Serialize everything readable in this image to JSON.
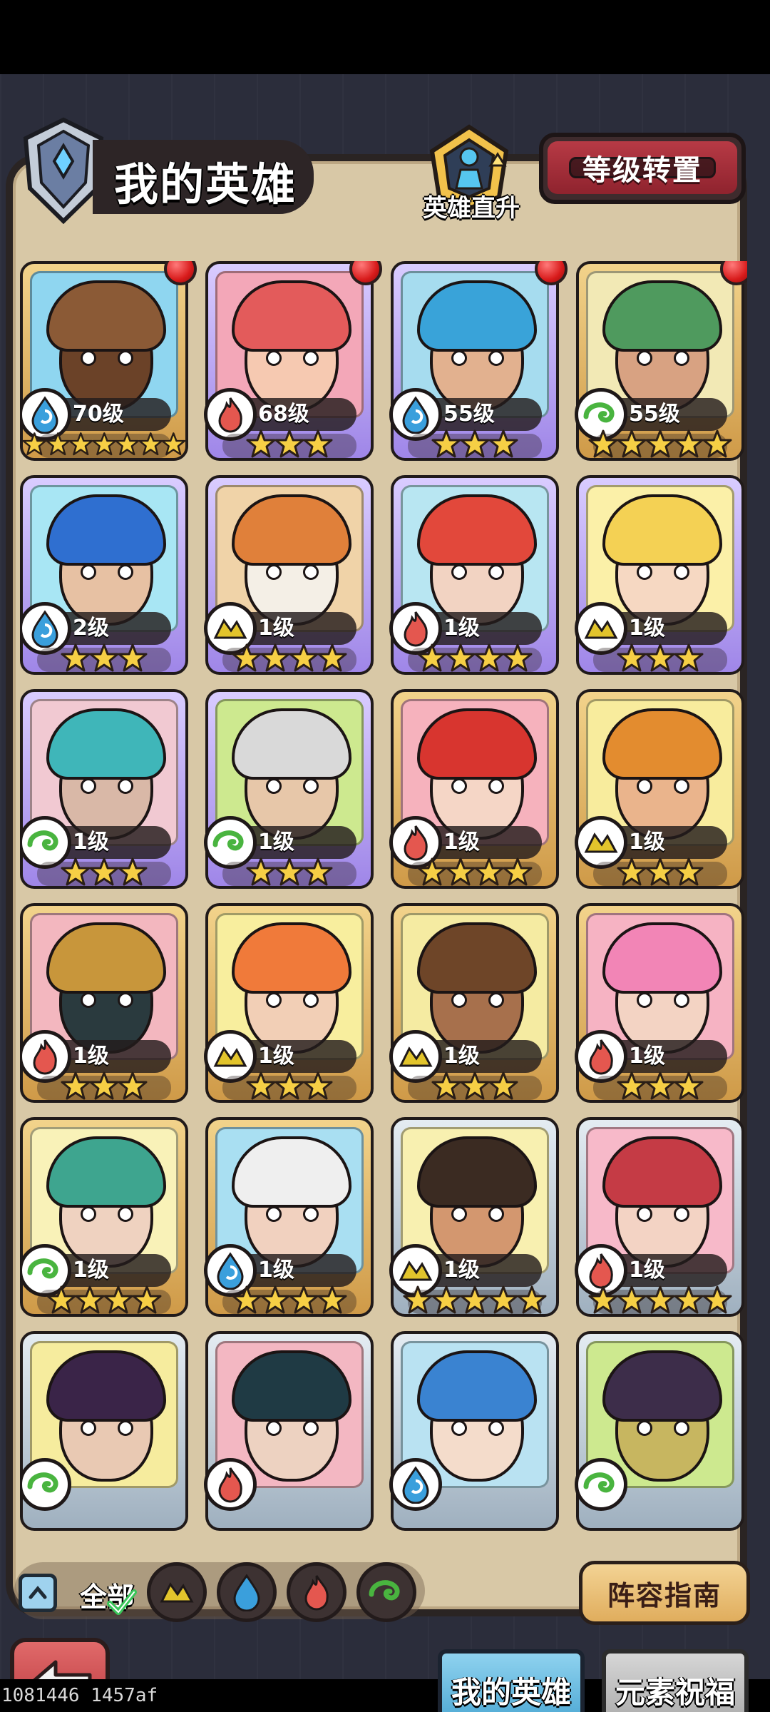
{
  "header": {
    "title": "我的英雄",
    "direct_upgrade_label": "英雄直升",
    "level_transfer_label": "等级转置"
  },
  "heroes": [
    {
      "level": "70级",
      "element": "water",
      "stars": 7,
      "frame": "gold",
      "notify": true,
      "palette": [
        "#8fd6f0",
        "#8b5a36",
        "#6b4228"
      ]
    },
    {
      "level": "68级",
      "element": "fire",
      "stars": 3,
      "frame": "purple",
      "notify": true,
      "palette": [
        "#f3a7b8",
        "#e35b5b",
        "#f6c9b1"
      ]
    },
    {
      "level": "55级",
      "element": "water",
      "stars": 3,
      "frame": "purple",
      "notify": true,
      "palette": [
        "#a6dcef",
        "#39a3d9",
        "#e2b18f"
      ]
    },
    {
      "level": "55级",
      "element": "wind",
      "stars": 5,
      "frame": "gold",
      "notify": true,
      "palette": [
        "#f2e9b5",
        "#4f9a5e",
        "#d8a282"
      ]
    },
    {
      "level": "2级",
      "element": "water",
      "stars": 3,
      "frame": "purple",
      "notify": false,
      "palette": [
        "#a8e6f4",
        "#2f6fd0",
        "#e7c1a3"
      ]
    },
    {
      "level": "1级",
      "element": "earth",
      "stars": 4,
      "frame": "purple",
      "notify": false,
      "palette": [
        "#f0d3a8",
        "#e0803a",
        "#f4efe6"
      ]
    },
    {
      "level": "1级",
      "element": "fire",
      "stars": 4,
      "frame": "purple",
      "notify": false,
      "palette": [
        "#b8e6f2",
        "#e2483b",
        "#f2d3c2"
      ]
    },
    {
      "level": "1级",
      "element": "earth",
      "stars": 3,
      "frame": "purple",
      "notify": false,
      "palette": [
        "#fbf0a8",
        "#f4d154",
        "#f6d8c2"
      ]
    },
    {
      "level": "1级",
      "element": "wind",
      "stars": 3,
      "frame": "purple",
      "notify": false,
      "palette": [
        "#f1c9d2",
        "#3fb6b9",
        "#d9b8a7"
      ]
    },
    {
      "level": "1级",
      "element": "wind",
      "stars": 3,
      "frame": "purple",
      "notify": false,
      "palette": [
        "#cde98f",
        "#d9d9d9",
        "#e7c7a9"
      ]
    },
    {
      "level": "1级",
      "element": "fire",
      "stars": 4,
      "frame": "gold",
      "notify": false,
      "palette": [
        "#f6b2bd",
        "#d8352f",
        "#f5d6c6"
      ]
    },
    {
      "level": "1级",
      "element": "earth",
      "stars": 3,
      "frame": "gold",
      "notify": false,
      "palette": [
        "#f8ec9d",
        "#e38c2f",
        "#eab48c"
      ]
    },
    {
      "level": "1级",
      "element": "fire",
      "stars": 3,
      "frame": "gold",
      "notify": false,
      "palette": [
        "#f3b7bf",
        "#c8963b",
        "#2a3a3e"
      ]
    },
    {
      "level": "1级",
      "element": "earth",
      "stars": 3,
      "frame": "gold",
      "notify": false,
      "palette": [
        "#f8ee9e",
        "#f07a3a",
        "#f2cfb6"
      ]
    },
    {
      "level": "1级",
      "element": "earth",
      "stars": 3,
      "frame": "gold",
      "notify": false,
      "palette": [
        "#f5eba2",
        "#6e4528",
        "#a7704c"
      ]
    },
    {
      "level": "1级",
      "element": "fire",
      "stars": 3,
      "frame": "gold",
      "notify": false,
      "palette": [
        "#f6b3c3",
        "#f285b6",
        "#f3d3c3"
      ]
    },
    {
      "level": "1级",
      "element": "wind",
      "stars": 4,
      "frame": "gold",
      "notify": false,
      "palette": [
        "#f9f2b8",
        "#3ea58f",
        "#efd2c0"
      ]
    },
    {
      "level": "1级",
      "element": "water",
      "stars": 4,
      "frame": "gold",
      "notify": false,
      "palette": [
        "#a9dff2",
        "#efefef",
        "#f1d1bf"
      ]
    },
    {
      "level": "1级",
      "element": "earth",
      "stars": 5,
      "frame": "silver",
      "notify": false,
      "palette": [
        "#f8f0b0",
        "#3b2b22",
        "#d3976f"
      ]
    },
    {
      "level": "1级",
      "element": "fire",
      "stars": 5,
      "frame": "silver",
      "notify": false,
      "palette": [
        "#f7b9c9",
        "#c53b45",
        "#f3d3c4"
      ]
    },
    {
      "level": "",
      "element": "wind",
      "stars": 0,
      "frame": "silver",
      "notify": false,
      "palette": [
        "#f6ec9e",
        "#3a2448",
        "#e9c9b3"
      ]
    },
    {
      "level": "",
      "element": "fire",
      "stars": 0,
      "frame": "silver",
      "notify": false,
      "palette": [
        "#f3b7c2",
        "#1f3a44",
        "#edd2c1"
      ]
    },
    {
      "level": "",
      "element": "water",
      "stars": 0,
      "frame": "silver",
      "notify": false,
      "palette": [
        "#b9e2f2",
        "#3a83d1",
        "#f4dccb"
      ]
    },
    {
      "level": "",
      "element": "wind",
      "stars": 0,
      "frame": "silver",
      "notify": false,
      "palette": [
        "#cde98f",
        "#3d2d4a",
        "#c7b660"
      ]
    }
  ],
  "filter": {
    "all_label": "全部",
    "elements": [
      "earth",
      "water",
      "fire",
      "wind"
    ]
  },
  "lineup_guide_label": "阵容指南",
  "tabs": {
    "my_heroes": "我的英雄",
    "element_blessing": "元素祝福"
  },
  "debug_overlay": "1081446 1457af",
  "colors": {
    "water": "#3a9fdc",
    "fire": "#e4574f",
    "wind": "#49b43f",
    "earth": "#e2c42c"
  }
}
